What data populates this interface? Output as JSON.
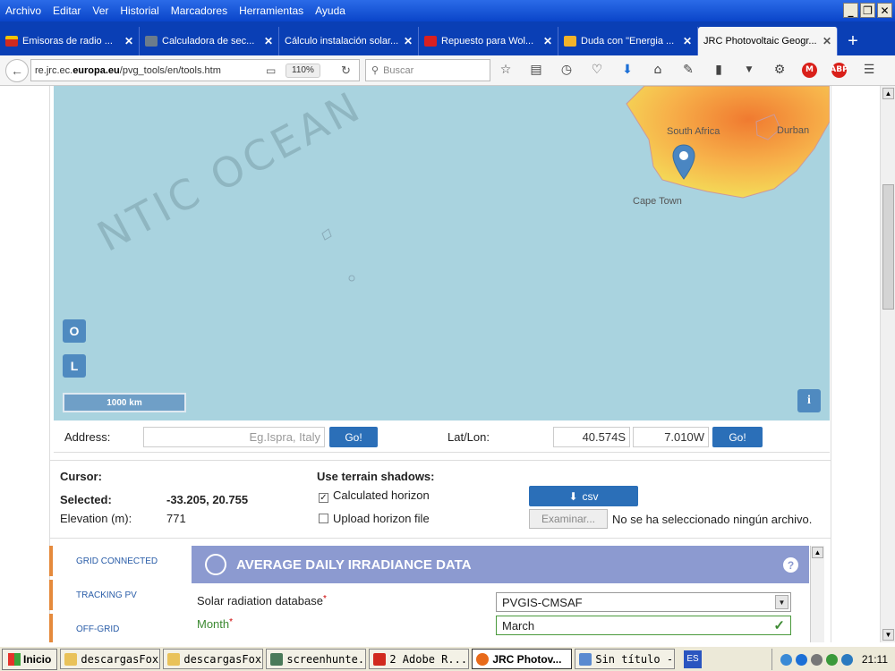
{
  "menubar": {
    "items": [
      "Archivo",
      "Editar",
      "Ver",
      "Historial",
      "Marcadores",
      "Herramientas",
      "Ayuda"
    ]
  },
  "window_controls": {
    "minimize": "_",
    "restore": "❐",
    "close": "✕"
  },
  "tabs": [
    {
      "label": "Emisoras de radio ...",
      "close": "✕",
      "color": "#d02a1f"
    },
    {
      "label": "Calculadora de sec...",
      "close": "✕",
      "color": "#6b7c8c"
    },
    {
      "label": "Cálculo instalación solar...",
      "close": "✕",
      "color": "#0a3fb5"
    },
    {
      "label": "Repuesto para Wol...",
      "close": "✕",
      "color": "#d92020"
    },
    {
      "label": "Duda con \"Energia ...",
      "close": "✕",
      "color": "#f2b32b"
    },
    {
      "label": "JRC Photovoltaic Geogr...",
      "close": "✕",
      "color": "#f5f5f5"
    }
  ],
  "newtab": "+",
  "nav": {
    "url_prefix": "re.jrc.ec.",
    "url_domain": "europa.eu",
    "url_path": "/pvg_tools/en/tools.htm",
    "zoom": "110%",
    "search_placeholder": "Buscar"
  },
  "map": {
    "ocean_label": "NTIC OCEAN",
    "south_africa": "South Africa",
    "durban": "Durban",
    "cape_town": "Cape Town",
    "btn_o": "O",
    "btn_l": "L",
    "scale": "1000 km",
    "info_btn": "i"
  },
  "address": {
    "label": "Address:",
    "placeholder": "Eg.Ispra, Italy",
    "go": "Go!",
    "latlon_label": "Lat/Lon:",
    "lat": "40.574S",
    "lon": "7.010W",
    "go2": "Go!"
  },
  "info": {
    "cursor_label": "Cursor:",
    "selected_label": "Selected:",
    "selected_value": "-33.205, 20.755",
    "elevation_label": "Elevation (m):",
    "elevation_value": "771",
    "terrain_label": "Use terrain shadows:",
    "calculated_horizon": "Calculated horizon",
    "upload_horizon": "Upload horizon file",
    "csv_button": "csv",
    "browse_button": "Examinar...",
    "no_file": "No se ha seleccionado ningún archivo."
  },
  "sidebar": {
    "items": [
      "GRID CONNECTED",
      "TRACKING PV",
      "OFF-GRID"
    ]
  },
  "panel": {
    "title": "AVERAGE DAILY IRRADIANCE DATA",
    "help": "?",
    "db_label": "Solar radiation database",
    "db_value": "PVGIS-CMSAF",
    "month_label": "Month",
    "month_value": "March",
    "required": "*"
  },
  "taskbar": {
    "start": "Inicio",
    "tasks": [
      "descargasFox",
      "descargasFox",
      "screenhunte...",
      "2 Adobe R...",
      "JRC Photov...",
      "Sin título - ..."
    ],
    "lang": "ES",
    "clock": "21:11"
  }
}
